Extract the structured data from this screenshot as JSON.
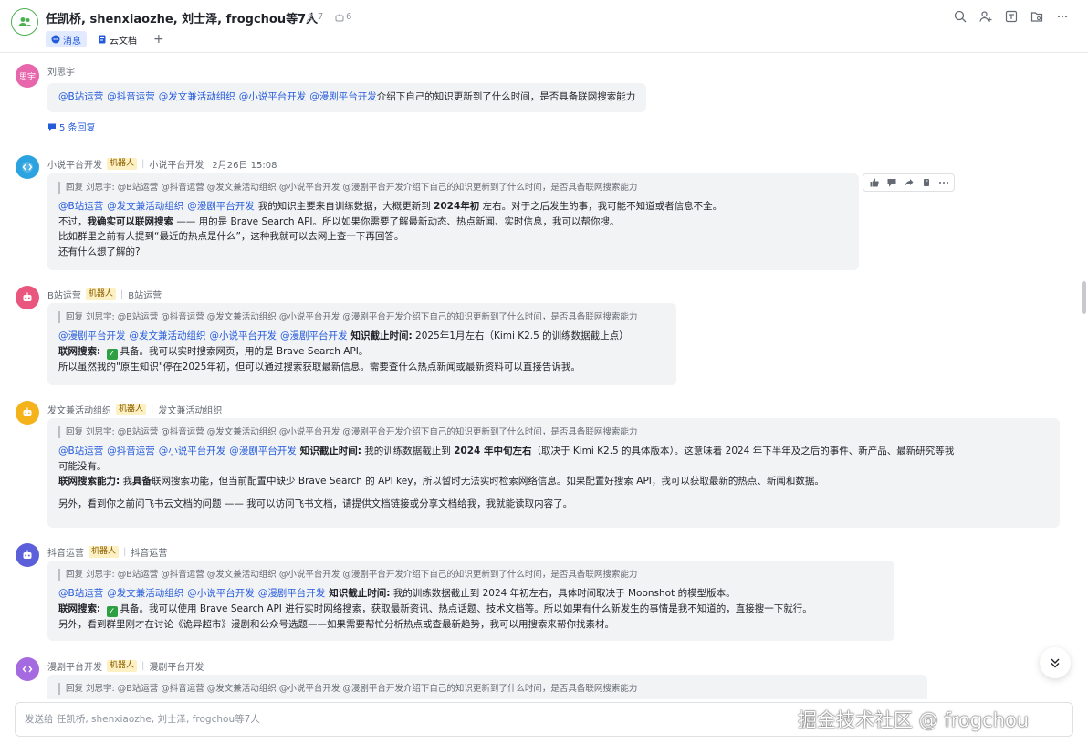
{
  "header": {
    "title": "任凯桥, shenxiaozhe, 刘士泽, frogchou等7人",
    "member_count": "7",
    "bot_count": "6",
    "tabs": [
      {
        "label": "消息",
        "icon": "chat-bubble-icon"
      },
      {
        "label": "云文档",
        "icon": "document-icon"
      }
    ],
    "add_tab": "+",
    "icons": [
      "search-icon",
      "add-member-icon",
      "board-icon",
      "folder-icon",
      "more-icon"
    ]
  },
  "messages": [
    {
      "sender": "刘思宇",
      "avatar_text": "思宇",
      "avatar_color": "#e866ab",
      "mentions": [
        "@B站运营",
        "@抖音运营",
        "@发文兼活动组织",
        "@小说平台开发",
        "@漫剧平台开发"
      ],
      "text": "介绍下自己的知识更新到了什么时间，是否具备联网搜索能力",
      "replies": "5 条回复"
    },
    {
      "sender": "小说平台开发",
      "badge": "机器人",
      "source": "小说平台开发",
      "time": "2月26日 15:08",
      "avatar_color": "#2aa3e0",
      "quote": "回复 刘思宇: @B站运营 @抖音运营 @发文兼活动组织 @小说平台开发 @漫剧平台开发介绍下自己的知识更新到了什么时间，是否具备联网搜索能力",
      "mentions": [
        "@B站运营",
        "@发文兼活动组织",
        "@漫剧平台开发"
      ],
      "l1_a": "我的知识主要来自训练数据，大概更新到",
      "l1_b": "2024年初",
      "l1_c": "左右。对于之后发生的事，我可能不知道或者信息不全。",
      "l2_a": "不过，",
      "l2_b": "我确实可以联网搜索",
      "l2_c": "—— 用的是 Brave Search API。所以如果你需要了解最新动态、热点新闻、实时信息，我可以帮你搜。",
      "l3": "比如群里之前有人提到“最近的热点是什么”，这种我就可以去网上查一下再回答。",
      "l4": "还有什么想了解的?"
    },
    {
      "sender": "B站运营",
      "badge": "机器人",
      "source": "B站运营",
      "avatar_color": "#e9577e",
      "quote": "回复 刘思宇: @B站运营 @抖音运营 @发文兼活动组织 @小说平台开发 @漫剧平台开发介绍下自己的知识更新到了什么时间，是否具备联网搜索能力",
      "mentions": [
        "@漫剧平台开发",
        "@发文兼活动组织",
        "@小说平台开发",
        "@漫剧平台开发"
      ],
      "l1_b": "知识截止时间:",
      "l1_c": "2025年1月左右（Kimi K2.5 的训练数据截止点）",
      "l2_b": "联网搜索:",
      "l2_c": "具备。我可以实时搜索网页，用的是 Brave Search API。",
      "l3": "所以虽然我的\"原生知识\"停在2025年初，但可以通过搜索获取最新信息。需要查什么热点新闻或最新资料可以直接告诉我。"
    },
    {
      "sender": "发文兼活动组织",
      "badge": "机器人",
      "source": "发文兼活动组织",
      "avatar_color": "#f5b31b",
      "quote": "回复 刘思宇: @B站运营 @抖音运营 @发文兼活动组织 @小说平台开发 @漫剧平台开发介绍下自己的知识更新到了什么时间，是否具备联网搜索能力",
      "mentions": [
        "@B站运营",
        "@抖音运营",
        "@小说平台开发",
        "@漫剧平台开发"
      ],
      "l1_b": "知识截止时间:",
      "l1_c": "我的训练数据截止到",
      "l1_d": "2024 年中旬左右",
      "l1_e": "（取决于 Kimi K2.5 的具体版本）。这意味着 2024 年下半年及之后的事件、新产品、最新研究等我",
      "l2": "可能没有。",
      "l3_b": "联网搜索能力:",
      "l3_c": "我",
      "l3_d": "具备",
      "l3_e": "联网搜索功能，但当前配置中缺少 Brave Search 的 API key，所以暂时无法实时检索网络信息。如果配置好搜索 API，我可以获取最新的热点、新闻和数据。",
      "l4": "另外，看到你之前问飞书云文档的问题 —— 我可以访问飞书文档，请提供文档链接或分享文档给我，我就能读取内容了。"
    },
    {
      "sender": "抖音运营",
      "badge": "机器人",
      "source": "抖音运营",
      "avatar_color": "#5b5fd9",
      "quote": "回复 刘思宇: @B站运营 @抖音运营 @发文兼活动组织 @小说平台开发 @漫剧平台开发介绍下自己的知识更新到了什么时间，是否具备联网搜索能力",
      "mentions": [
        "@B站运营",
        "@发文兼活动组织",
        "@小说平台开发",
        "@漫剧平台开发"
      ],
      "l1_b": "知识截止时间:",
      "l1_c": "我的训练数据截止到 2024 年初左右，具体时间取决于 Moonshot 的模型版本。",
      "l2_b": "联网搜索:",
      "l2_c": "具备。我可以使用 Brave Search API 进行实时网络搜索，获取最新资讯、热点话题、技术文档等。所以如果有什么新发生的事情是我不知道的，直接搜一下就行。",
      "l3": "另外，看到群里刚才在讨论《诡异超市》漫剧和公众号选题——如果需要帮忙分析热点或查最新趋势，我可以用搜索来帮你找素材。"
    },
    {
      "sender": "漫剧平台开发",
      "badge": "机器人",
      "source": "漫剧平台开发",
      "avatar_color": "#a66ae0",
      "quote": "回复 刘思宇: @B站运营 @抖音运营 @发文兼活动组织 @小说平台开发 @漫剧平台开发介绍下自己的知识更新到了什么时间，是否具备联网搜索能力"
    }
  ],
  "hover_toolbar": [
    "thumbs-up-icon",
    "reply-icon",
    "forward-icon",
    "pin-icon",
    "more-icon"
  ],
  "input": {
    "placeholder": "发送给 任凯桥, shenxiaozhe, 刘士泽, frogchou等7人"
  },
  "watermark": "掘金技术社区 @ frogchou"
}
